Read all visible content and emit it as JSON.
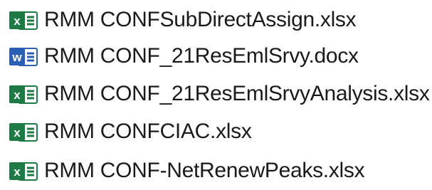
{
  "files": [
    {
      "name": "RMM CONFSubDirectAssign.xlsx",
      "icon": "excel-file-icon",
      "badge_letter": "x",
      "accent": "#1d7a45"
    },
    {
      "name": "RMM CONF_21ResEmlSrvy.docx",
      "icon": "word-file-icon",
      "badge_letter": "w",
      "accent": "#2b5fb4"
    },
    {
      "name": "RMM CONF_21ResEmlSrvyAnalysis.xlsx",
      "icon": "excel-file-icon",
      "badge_letter": "x",
      "accent": "#1d7a45"
    },
    {
      "name": "RMM CONFCIAC.xlsx",
      "icon": "excel-file-icon",
      "badge_letter": "x",
      "accent": "#1d7a45"
    },
    {
      "name": "RMM CONF-NetRenewPeaks.xlsx",
      "icon": "excel-file-icon",
      "badge_letter": "x",
      "accent": "#1d7a45"
    }
  ]
}
